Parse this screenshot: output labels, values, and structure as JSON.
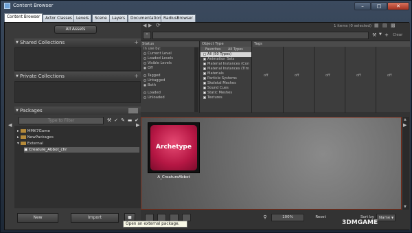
{
  "window": {
    "title": "Content Browser"
  },
  "tabs": [
    "Content Browser",
    "Actor Classes",
    "Levels",
    "Scene",
    "Layers",
    "Documentation",
    "RadiusBrowser"
  ],
  "left": {
    "all_assets": "All Assets",
    "shared_collections": "Shared Collections",
    "private_collections": "Private Collections",
    "packages": "Packages",
    "filter_placeholder": "Type to Filter",
    "tree": [
      "MMK7Game",
      "NewPackages",
      "External",
      "Creature_Abbot_chr"
    ],
    "new_btn": "New",
    "import_btn": "Import"
  },
  "right": {
    "items_count": "1 items (0 selected)",
    "clear": "Clear",
    "status": {
      "head": "Status",
      "in_use_by": "In use by:",
      "items": [
        "Current Level",
        "Loaded Levels",
        "Visible Levels",
        "Off"
      ],
      "tagged": [
        "Tagged",
        "Untagged",
        "Both"
      ],
      "loaded": [
        "Loaded",
        "Unloaded"
      ]
    },
    "object_type": {
      "head": "Object Type",
      "tabs": [
        "Favorites",
        "All Types"
      ],
      "items": [
        "All (50 Types)",
        "Animation Sets",
        "Material Instances (Con",
        "Material Instances (Tim",
        "Materials",
        "Particle Systems",
        "Skeletal Meshes",
        "Sound Cues",
        "Static Meshes",
        "Textures"
      ]
    },
    "tags_head": "Tags",
    "off_labels": [
      "off",
      "off",
      "off",
      "off",
      "off"
    ],
    "asset": {
      "thumb_label": "Archetype",
      "name": "A_CreatureAbbot"
    },
    "zoom": "100%",
    "reset": "Reset",
    "sort_by": "Sort by",
    "sort_value": "Name"
  },
  "tooltip": "Open an external package.",
  "watermark": "3DMGAME"
}
